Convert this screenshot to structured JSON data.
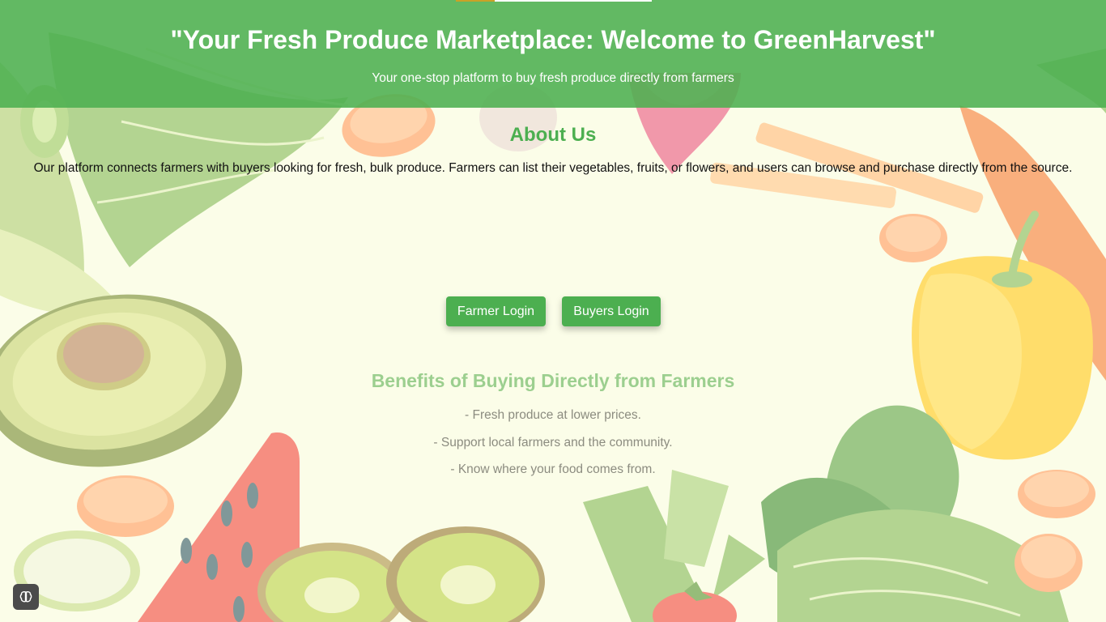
{
  "header": {
    "title": "\"Your Fresh Produce Marketplace: Welcome to GreenHarvest\"",
    "subtitle": "Your one-stop platform to buy fresh produce directly from farmers"
  },
  "about": {
    "title": "About Us",
    "text": "Our platform connects farmers with buyers looking for fresh, bulk produce. Farmers can list their vegetables, fruits, or flowers, and users can browse and purchase directly from the source."
  },
  "buttons": {
    "farmer_login": "Farmer Login",
    "buyers_login": "Buyers Login"
  },
  "benefits": {
    "title": "Benefits of Buying Directly from Farmers",
    "items": [
      "- Fresh produce at lower prices.",
      "- Support local farmers and the community.",
      "- Know where your food comes from."
    ]
  },
  "colors": {
    "header_green": "#4caf50",
    "button_green": "#4caf50",
    "background_cream": "#fbfde9"
  },
  "icons": {
    "floating_button": "brain-icon"
  }
}
